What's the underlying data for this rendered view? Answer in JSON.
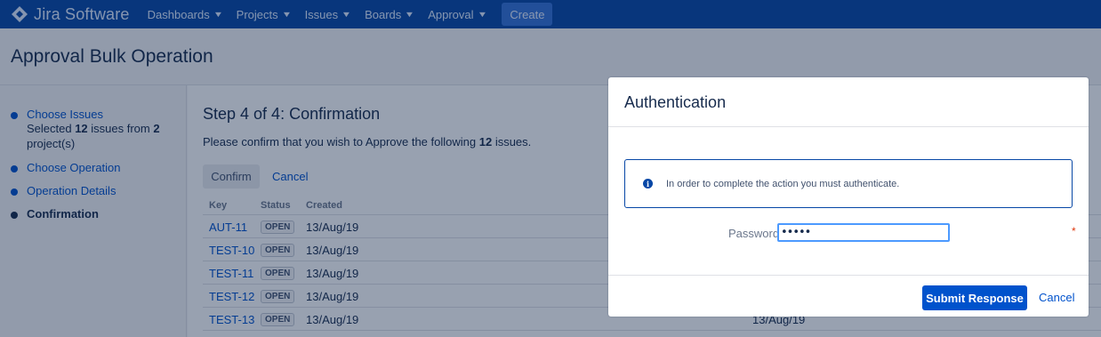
{
  "app": {
    "brand": "Jira Software"
  },
  "nav": {
    "items": [
      {
        "label": "Dashboards"
      },
      {
        "label": "Projects"
      },
      {
        "label": "Issues"
      },
      {
        "label": "Boards"
      },
      {
        "label": "Approval"
      }
    ],
    "create_label": "Create"
  },
  "page": {
    "title": "Approval Bulk Operation"
  },
  "sidebar": {
    "steps": [
      {
        "label": "Choose Issues"
      },
      {
        "label": "Choose Operation"
      },
      {
        "label": "Operation Details"
      },
      {
        "label": "Confirmation"
      }
    ],
    "selected": {
      "prefix": "Selected ",
      "count": "12",
      "middle": " issues from ",
      "projects": "2",
      "suffix": " project(s)"
    }
  },
  "main": {
    "heading": "Step 4 of 4: Confirmation",
    "confirm_prefix": "Please confirm that you wish to Approve the following ",
    "confirm_count": "12",
    "confirm_suffix": " issues.",
    "confirm_button": "Confirm",
    "cancel_link": "Cancel",
    "columns": {
      "key": "Key",
      "status": "Status",
      "created": "Created"
    },
    "rows": [
      {
        "key": "AUT-11",
        "status": "OPEN",
        "created": "13/Aug/19"
      },
      {
        "key": "TEST-10",
        "status": "OPEN",
        "created": "13/Aug/19"
      },
      {
        "key": "TEST-11",
        "status": "OPEN",
        "created": "13/Aug/19"
      },
      {
        "key": "TEST-12",
        "status": "OPEN",
        "created": "13/Aug/19"
      },
      {
        "key": "TEST-13",
        "status": "OPEN",
        "created": "13/Aug/19",
        "created2": "13/Aug/19"
      }
    ]
  },
  "dialog": {
    "title": "Authentication",
    "message": "In order to complete the action you must authenticate.",
    "password_label": "Password",
    "password_value": "•••••",
    "required_mark": "*",
    "submit_label": "Submit Response",
    "cancel_label": "Cancel"
  },
  "colors": {
    "nav": "#0747a6",
    "link": "#0052cc",
    "primary_button": "#0052cc"
  },
  "icons": {
    "logo": "jira-diamond-icon",
    "info": "info-icon",
    "chevron": "chevron-down-icon"
  }
}
